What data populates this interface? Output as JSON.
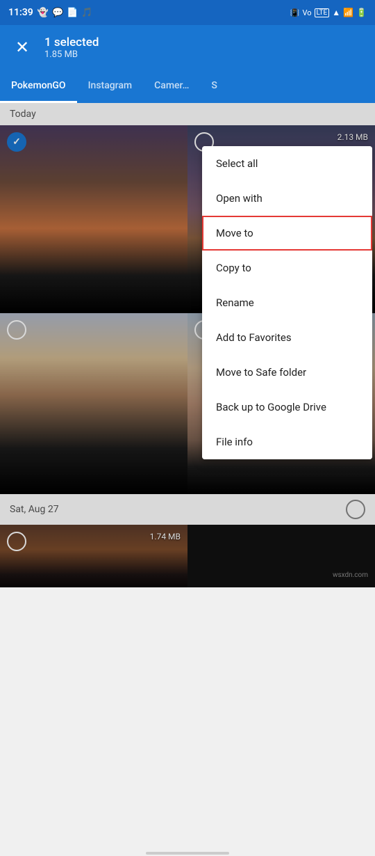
{
  "status_bar": {
    "time": "11:39",
    "left_icons": [
      "snapchat",
      "messaging",
      "files",
      "shazam"
    ],
    "right_icons": [
      "vibrate",
      "wifi-calling",
      "hotspot",
      "lte",
      "signal",
      "signal2",
      "battery"
    ]
  },
  "app_bar": {
    "close_label": "×",
    "selection_title": "1 selected",
    "selection_size": "1.85 MB"
  },
  "tabs": [
    {
      "label": "PokemonGO",
      "active": true
    },
    {
      "label": "Instagram",
      "active": false
    },
    {
      "label": "Camer…",
      "active": false
    },
    {
      "label": "S",
      "active": false
    }
  ],
  "date_today": "Today",
  "photos": [
    {
      "id": 1,
      "selected": true,
      "size": null
    },
    {
      "id": 2,
      "selected": false,
      "size": "2.13 MB"
    },
    {
      "id": 3,
      "selected": false,
      "size": null
    },
    {
      "id": 4,
      "selected": false,
      "size": null
    }
  ],
  "date_sat": "Sat, Aug 27",
  "photo_bottom": {
    "selected": false,
    "size": "1.74 MB"
  },
  "menu": {
    "items": [
      {
        "id": "select-all",
        "label": "Select all",
        "highlighted": false
      },
      {
        "id": "open-with",
        "label": "Open with",
        "highlighted": false
      },
      {
        "id": "move-to",
        "label": "Move to",
        "highlighted": true
      },
      {
        "id": "copy-to",
        "label": "Copy to",
        "highlighted": false
      },
      {
        "id": "rename",
        "label": "Rename",
        "highlighted": false
      },
      {
        "id": "add-to-favorites",
        "label": "Add to Favorites",
        "highlighted": false
      },
      {
        "id": "move-to-safe",
        "label": "Move to Safe folder",
        "highlighted": false
      },
      {
        "id": "backup",
        "label": "Back up to Google Drive",
        "highlighted": false
      },
      {
        "id": "file-info",
        "label": "File info",
        "highlighted": false
      }
    ]
  },
  "watermark": "wsxdn.com",
  "colors": {
    "primary": "#1976d2",
    "highlight_border": "#e53935"
  }
}
